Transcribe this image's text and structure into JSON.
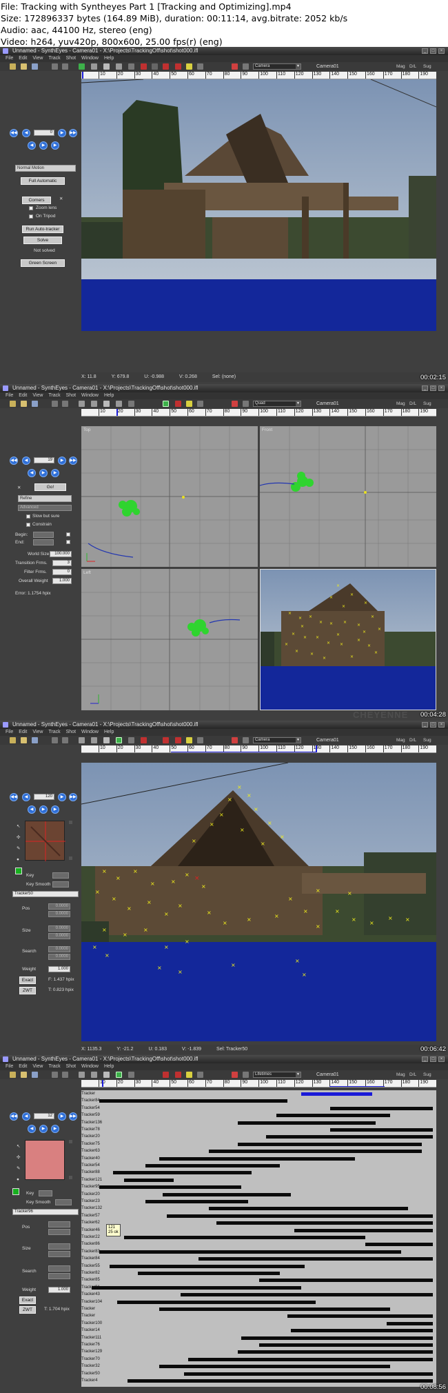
{
  "header": {
    "file": "File: Tracking with Syntheyes Part 1 [Tracking and Optimizing].mp4",
    "size": "Size: 172896337 bytes (164.89 MiB), duration: 00:11:14, avg.bitrate: 2052 kb/s",
    "audio": "Audio: aac, 44100 Hz, stereo (eng)",
    "video": "Video: h264, yuv420p, 800x600, 25.00 fps(r) (eng)"
  },
  "app": {
    "title_1": "Unnamed - SynthEyes - Camera01 - X:\\Projects\\TrackingOff\\shot\\shot000.ifl",
    "title_2": "Unnamed - SynthEyes - Camera01 - X:\\Projects\\TrackingOff\\shot\\shot000.ifl",
    "title_3": "Unnamed - SynthEyes - Camera01 - X:\\Projects\\TrackingOff\\shot\\shot000.ifl",
    "title_4": "Unnamed - SynthEyes - Camera01 - X:\\Projects\\TrackingOff\\shot\\shot000.ifl",
    "menu": [
      "File",
      "Edit",
      "View",
      "Track",
      "Shot",
      "Window",
      "Help"
    ],
    "toolbar_right": [
      "Mag",
      "D/L",
      "Sug"
    ],
    "camera_name": "Camera01",
    "colors": {
      "pov_blue": "#13279a",
      "tracker": "#f2ef1c",
      "timeline_blue": "#1a1ad8",
      "point_cloud": "#2fd42f"
    }
  },
  "ruler_ticks": [
    "10",
    "20",
    "30",
    "40",
    "50",
    "60",
    "70",
    "80",
    "90",
    "100",
    "110",
    "120",
    "130",
    "140",
    "150",
    "160",
    "170",
    "180",
    "190"
  ],
  "frames": [
    {
      "view_mode": "Camera",
      "panel": {
        "frame_number": "0",
        "motion_dropdown": "Normal Motion",
        "full_automatic": "Full Automatic",
        "corners": "Corners",
        "zoom_lens": "Zoom lens",
        "on_tripod": "On Tripod",
        "run_autotracker": "Run Auto-tracker",
        "solve": "Solve",
        "status": "Not solved",
        "green_screen": "Green Screen"
      },
      "status": {
        "x": "X:   11.8",
        "y": "Y:   679.8",
        "u": "U:   -0.988",
        "v": "V:   0.268",
        "sel": "Sel: (none)"
      },
      "timestamp": "00:02:15"
    },
    {
      "view_mode": "Quad",
      "panel": {
        "frame_number": "19",
        "go": "Go!",
        "refine": "Refine",
        "advanced": "Advanced",
        "slow_but_sure": "Slow but sure",
        "constrain": "Constrain",
        "begin": "Begin:",
        "end": "End:",
        "world_size_label": "World Size",
        "world_size": "100.000",
        "transition_label": "Transition Frms.",
        "transition": "3",
        "filter_label": "Filter Frms.",
        "filter": "0",
        "weight_label": "Overall Weight",
        "weight": "1.000",
        "error": "Error:   1.1754 hpix"
      },
      "viewports": [
        "Top",
        "Front",
        "Left"
      ],
      "timestamp": "00:04:28"
    },
    {
      "view_mode": "Camera",
      "panel": {
        "frame_number": "120",
        "key": "Key",
        "key_smooth": "Key Smooth",
        "tracker_name": "Tracker50",
        "pos": "Pos",
        "pos_x": "0.0000",
        "pos_y": "0.0000",
        "size": "Size",
        "size_x": "0.0000",
        "size_y": "0.0000",
        "search": "Search",
        "search_x": "0.0000",
        "search_y": "0.0000",
        "weight": "Weight",
        "weight_val": "1.000",
        "exact": "Exact",
        "zwt": "ZWT",
        "f_err": "F: 1.437 hpix",
        "t_err": "T: 0.823 hpix"
      },
      "status": {
        "x": "X:   1135.3",
        "y": "Y:   -21.2",
        "u": "U:   0.183",
        "v": "V:   -1.839",
        "sel": "Sel: Tracker50"
      },
      "timestamp": "00:06:42"
    },
    {
      "view_mode": "Lifetimes",
      "panel": {
        "frame_number": "12",
        "key": "Key",
        "key_smooth": "Key Smooth",
        "tracker_name": "Tracker96",
        "pos": "Pos",
        "size": "Size",
        "search": "Search",
        "weight": "Weight",
        "weight_val": "1.000",
        "exact": "Exact",
        "zwt": "ZWT",
        "t_err": "T: 1.704 hpix"
      },
      "tooltip_line1": "121",
      "tooltip_line2": "25 ok",
      "tracks": [
        {
          "name": "Tracker",
          "start": 0.62,
          "end": 0.82
        },
        {
          "name": "Tracker84",
          "start": 0.05,
          "end": 0.58
        },
        {
          "name": "Tracker54",
          "start": 0.7,
          "end": 0.99
        },
        {
          "name": "Tracker59",
          "start": 0.55,
          "end": 0.87
        },
        {
          "name": "Tracker136",
          "start": 0.44,
          "end": 0.83
        },
        {
          "name": "Tracker78",
          "start": 0.7,
          "end": 0.99
        },
        {
          "name": "Tracker20",
          "start": 0.52,
          "end": 0.99
        },
        {
          "name": "Tracker75",
          "start": 0.44,
          "end": 0.96
        },
        {
          "name": "Tracker63",
          "start": 0.36,
          "end": 0.96
        },
        {
          "name": "Tracker40",
          "start": 0.22,
          "end": 0.77
        },
        {
          "name": "Tracker54",
          "start": 0.18,
          "end": 0.56
        },
        {
          "name": "Tracker88",
          "start": 0.09,
          "end": 0.48
        },
        {
          "name": "Tracker121",
          "start": 0.12,
          "end": 0.26
        },
        {
          "name": "Tracker95",
          "start": 0.05,
          "end": 0.45
        },
        {
          "name": "Tracker20",
          "start": 0.23,
          "end": 0.59
        },
        {
          "name": "Tracker23",
          "start": 0.18,
          "end": 0.47
        },
        {
          "name": "Tracker132",
          "start": 0.36,
          "end": 0.92
        },
        {
          "name": "Tracker57",
          "start": 0.24,
          "end": 0.99
        },
        {
          "name": "Tracker62",
          "start": 0.38,
          "end": 0.99
        },
        {
          "name": "Tracker46",
          "start": 0.6,
          "end": 0.99
        },
        {
          "name": "Tracker22",
          "start": 0.12,
          "end": 0.8
        },
        {
          "name": "Tracker86",
          "start": 0.8,
          "end": 0.99
        },
        {
          "name": "Tracker83",
          "start": 0.05,
          "end": 0.9
        },
        {
          "name": "Tracker84",
          "start": 0.33,
          "end": 0.99
        },
        {
          "name": "Tracker55",
          "start": 0.08,
          "end": 0.63
        },
        {
          "name": "Tracker82",
          "start": 0.16,
          "end": 0.56
        },
        {
          "name": "Tracker85",
          "start": 0.5,
          "end": 0.99
        },
        {
          "name": "Tracker91",
          "start": 0.03,
          "end": 0.62
        },
        {
          "name": "Tracker43",
          "start": 0.28,
          "end": 0.99
        },
        {
          "name": "Tracker104",
          "start": 0.1,
          "end": 0.66
        },
        {
          "name": "Tracker",
          "start": 0.22,
          "end": 0.87
        },
        {
          "name": "Tracker",
          "start": 0.58,
          "end": 0.99
        },
        {
          "name": "Tracker100",
          "start": 0.86,
          "end": 0.99
        },
        {
          "name": "Tracker14",
          "start": 0.59,
          "end": 0.99
        },
        {
          "name": "Tracker111",
          "start": 0.45,
          "end": 0.99
        },
        {
          "name": "Tracker76",
          "start": 0.5,
          "end": 0.99
        },
        {
          "name": "Tracker129",
          "start": 0.44,
          "end": 0.99
        },
        {
          "name": "Tracker70",
          "start": 0.3,
          "end": 0.99
        },
        {
          "name": "Tracker32",
          "start": 0.22,
          "end": 0.87
        },
        {
          "name": "Tracker50",
          "start": 0.29,
          "end": 0.99
        },
        {
          "name": "Tracker4",
          "start": 0.13,
          "end": 0.99
        }
      ],
      "timestamp": "00:08:56"
    }
  ]
}
